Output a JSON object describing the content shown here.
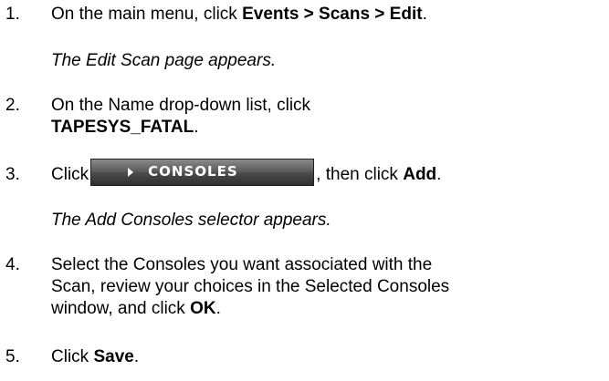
{
  "steps": [
    {
      "num": "1.",
      "pre": "On the main menu, click ",
      "bold": "Events > Scans > Edit",
      "post": "."
    },
    {
      "num": "2.",
      "line1": "On the Name drop-down list, click",
      "bold": "TAPESYS_FATAL",
      "post": "."
    },
    {
      "num": "3.",
      "pre": "Click",
      "button_label": "CONSOLES",
      "mid": ", then click ",
      "bold": "Add",
      "post": "."
    },
    {
      "num": "4.",
      "line1": "Select the Consoles you want associated with the",
      "line2": "Scan, review your choices in the Selected Consoles",
      "line3_pre": "window, and click ",
      "bold": "OK",
      "post": "."
    },
    {
      "num": "5.",
      "pre": "Click ",
      "bold": "Save",
      "post": "."
    }
  ],
  "notes": [
    "The Edit Scan page appears.",
    "The Add Consoles selector appears."
  ]
}
